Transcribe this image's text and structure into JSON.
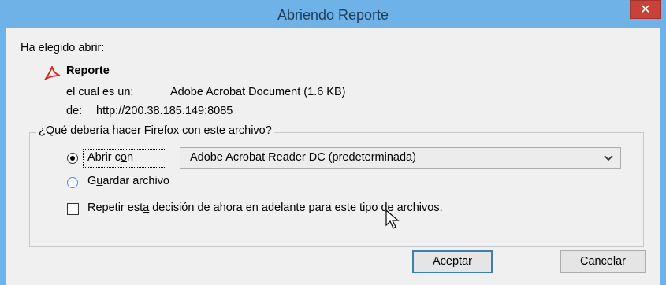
{
  "window": {
    "title": "Abriendo Reporte",
    "close_symbol": "✕"
  },
  "intro": "Ha elegido abrir:",
  "file": {
    "name": "Reporte",
    "type_label": "el cual es un:",
    "type_value": "Adobe Acrobat Document (1.6 KB)",
    "from_label": "de:",
    "from_value": "http://200.38.185.149:8085",
    "icon": "pdf-file-icon"
  },
  "action_group": {
    "legend": "¿Qué debería hacer Firefox con este archivo?",
    "open_with": {
      "label_pre": "Abrir c",
      "label_access": "o",
      "label_post": "n",
      "checked": true
    },
    "app_select": {
      "value": "Adobe Acrobat Reader DC  (predeterminada)"
    },
    "save_file": {
      "label_pre": "G",
      "label_access": "u",
      "label_post": "ardar archivo",
      "checked": false
    },
    "remember": {
      "label_pre": "Repetir est",
      "label_access": "a",
      "label_post": " decisión de ahora en adelante para este tipo de archivos.",
      "checked": false
    }
  },
  "buttons": {
    "ok": "Aceptar",
    "cancel": "Cancelar"
  },
  "colors": {
    "titlebar": "#6fb2e8",
    "close": "#c7433a",
    "dialog_bg": "#f0f0f0",
    "accent": "#3c7fb1"
  }
}
